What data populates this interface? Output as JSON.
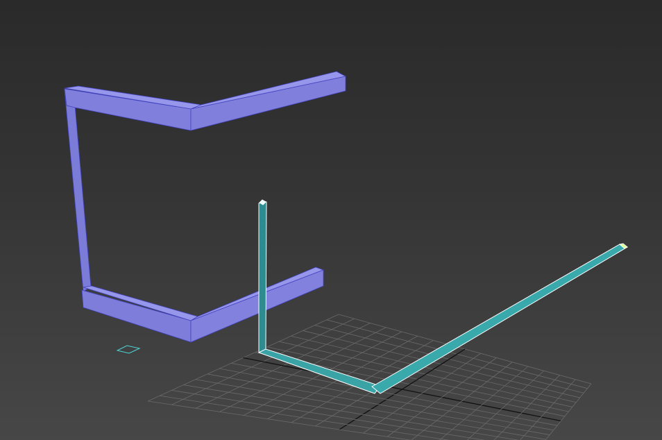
{
  "viewport": {
    "view": "perspective",
    "grid": {
      "divisions": 16,
      "line_color": "#6a6a6a",
      "axis_color": "#111111"
    },
    "objects": [
      {
        "name": "purple-frame",
        "color": "#8585e0",
        "shade": "#6c6cc8",
        "edge": "#3a3ab8"
      },
      {
        "name": "cyan-frame-selected",
        "color": "#2f8f92",
        "shade": "#3fb0b3",
        "edge": "#ffffff"
      },
      {
        "name": "small-helper",
        "color": "#4fd6d6"
      }
    ]
  }
}
